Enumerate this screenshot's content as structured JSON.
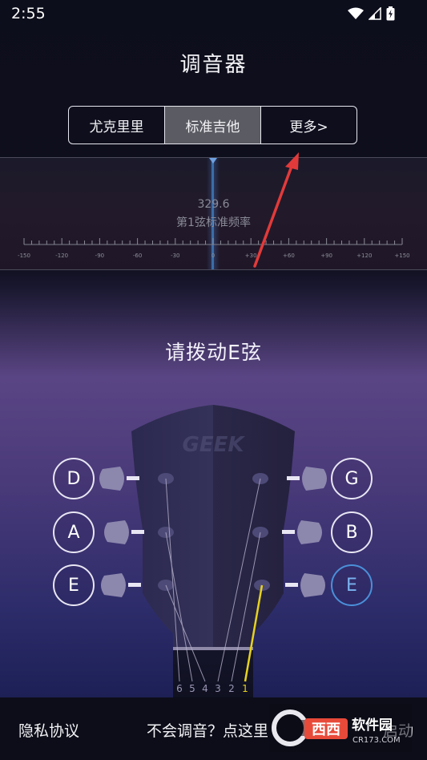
{
  "status": {
    "time": "2:55"
  },
  "title": "调音器",
  "tabs": [
    {
      "label": "尤克里里",
      "active": false
    },
    {
      "label": "标准吉他",
      "active": true
    },
    {
      "label": "更多>",
      "active": false
    }
  ],
  "tuner": {
    "frequency": "329.6",
    "frequency_label": "第1弦标准频率",
    "scale_labels": [
      "-150",
      "-120",
      "-90",
      "-60",
      "-30",
      "0",
      "+30",
      "+60",
      "+90",
      "+120",
      "+150"
    ],
    "needle_offset": 0
  },
  "instruction": "请拨动E弦",
  "headstock": {
    "logo": "GEEK",
    "string_numbers": [
      "6",
      "5",
      "4",
      "3",
      "2",
      "1"
    ],
    "active_string": "1",
    "left_pegs": [
      "D",
      "A",
      "E"
    ],
    "right_pegs": [
      "G",
      "B",
      "E"
    ],
    "active_peg": "right-3"
  },
  "footer": {
    "privacy": "隐私协议",
    "help": "不会调音？点这里",
    "auto": "启动"
  },
  "watermark": {
    "text": "软件园",
    "subtext": "CR173.COM"
  },
  "colors": {
    "accent": "#4a90d9",
    "active_string": "#e6d21e",
    "arrow": "#e23a3a"
  }
}
